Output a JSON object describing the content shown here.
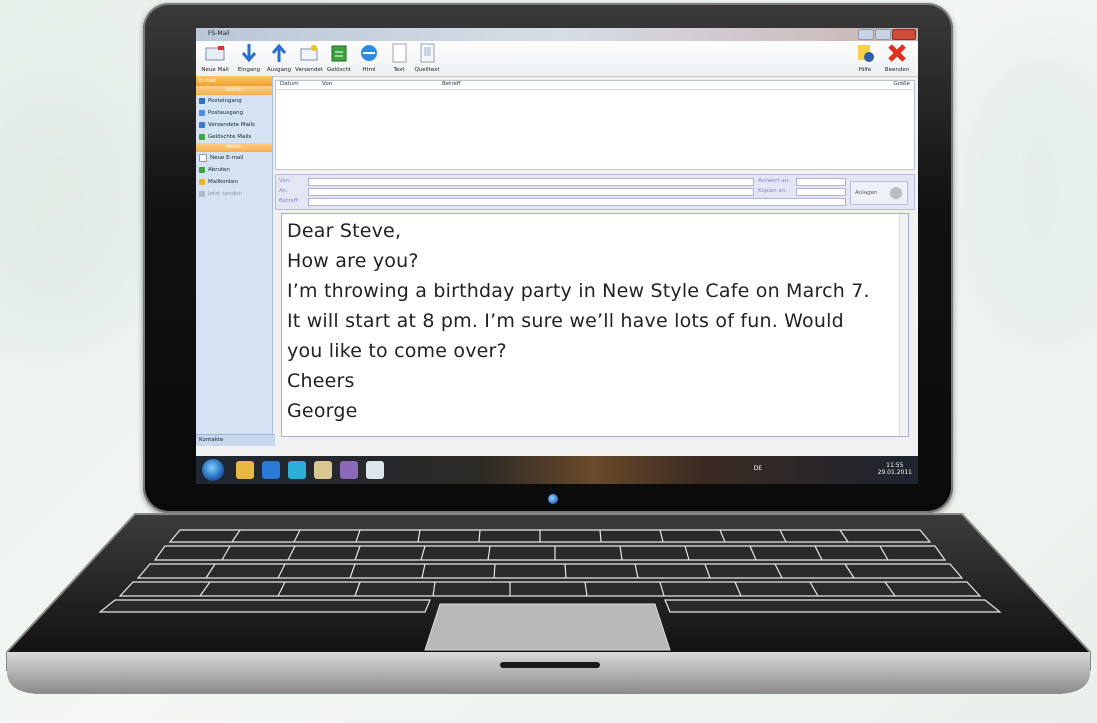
{
  "window": {
    "title": "FS-Mail"
  },
  "toolbar": {
    "items": [
      "Neue Mail",
      "Eingang",
      "Ausgang",
      "Versendet",
      "Gelöscht",
      "Html",
      "Text",
      "Quelltext"
    ],
    "help": "Hilfe",
    "exit": "Beenden"
  },
  "sidebar": {
    "header": "E-mail",
    "section1": "Ordner",
    "folders": [
      "Posteingang",
      "Postausgang",
      "Versendete Mails",
      "Gelöschte Mails"
    ],
    "section2": "Aktion",
    "actions": [
      "Neue E-mail",
      "Abrufen",
      "Mailkonten",
      "Jetzt senden"
    ],
    "footer": "Kontakte"
  },
  "list": {
    "columns": [
      "Datum",
      "Von",
      "Betreff",
      "Größe"
    ]
  },
  "fields": {
    "from": "Von:",
    "to": "An:",
    "subject": "Betreff:",
    "reply_to": "Antwort an:",
    "cc": "Kopien an:",
    "attach": "Anlagen"
  },
  "body": {
    "lines": [
      "Dear Steve,",
      "How are you?",
      "I’m throwing a birthday party in New Style Cafe on March 7.",
      "It will start at 8 pm. I’m sure we’ll have lots of fun. Would",
      "you like to come over?",
      "Cheers",
      "George"
    ]
  },
  "tray": {
    "lang": "DE",
    "time": "11:55",
    "date": "29.01.2011"
  },
  "colors": {
    "accent": "#f0a030",
    "sidebar": "#d4e2f3",
    "close": "#d04a3a"
  }
}
